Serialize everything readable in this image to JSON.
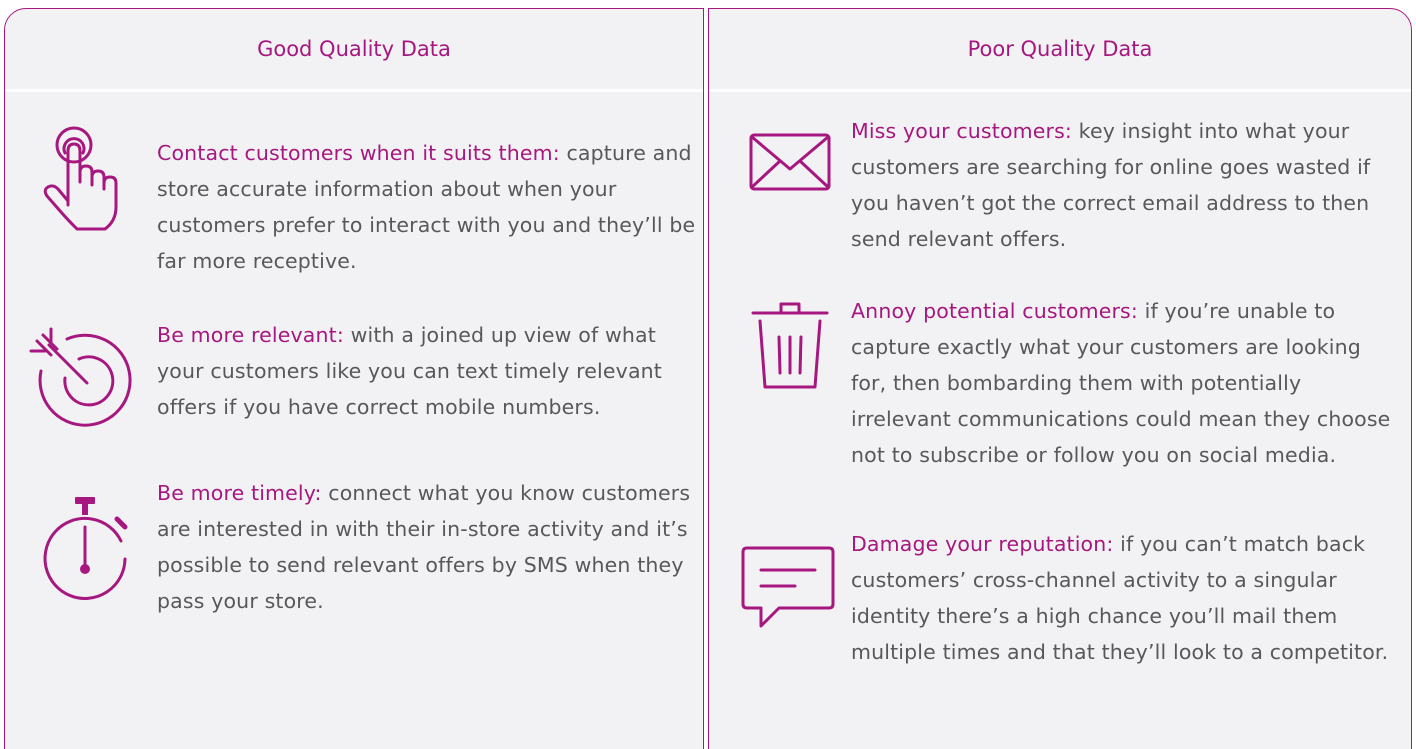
{
  "columns": [
    {
      "heading": "Good Quality Data",
      "items": [
        {
          "icon": "touch-hand-icon",
          "lead": "Contact customers when it suits them:",
          "body": "capture and store accurate information about when your customers prefer to interact with you and they’ll be far more receptive."
        },
        {
          "icon": "target-arrow-icon",
          "lead": "Be more relevant:",
          "body": "with a joined up view of what your customers like you can text timely relevant offers if you have correct mobile numbers."
        },
        {
          "icon": "stopwatch-icon",
          "lead": "Be more timely:",
          "body": "connect what you know customers are interested in with their in-store activity and it’s possible to send relevant offers by SMS when they pass your store."
        }
      ]
    },
    {
      "heading": "Poor Quality Data",
      "items": [
        {
          "icon": "envelope-icon",
          "lead": "Miss your customers:",
          "body": "key insight into what your customers are searching for online goes wasted if you haven’t got the correct email address to then send relevant offers."
        },
        {
          "icon": "trash-bin-icon",
          "lead": "Annoy potential customers:",
          "body": "if you’re unable to capture exactly what your customers are looking for, then bombarding them with potentially irrelevant communications could mean they choose not to subscribe or follow you on social media."
        },
        {
          "icon": "speech-bubble-icon",
          "lead": "Damage your reputation:",
          "body": "if you can’t match back customers’ cross-channel activity to a singular identity there’s a high chance you’ll mail them multiple times and that they’ll look to a competitor."
        }
      ]
    }
  ],
  "colors": {
    "accent": "#a6177f",
    "text": "#57585b",
    "panel": "#f2f2f4"
  }
}
